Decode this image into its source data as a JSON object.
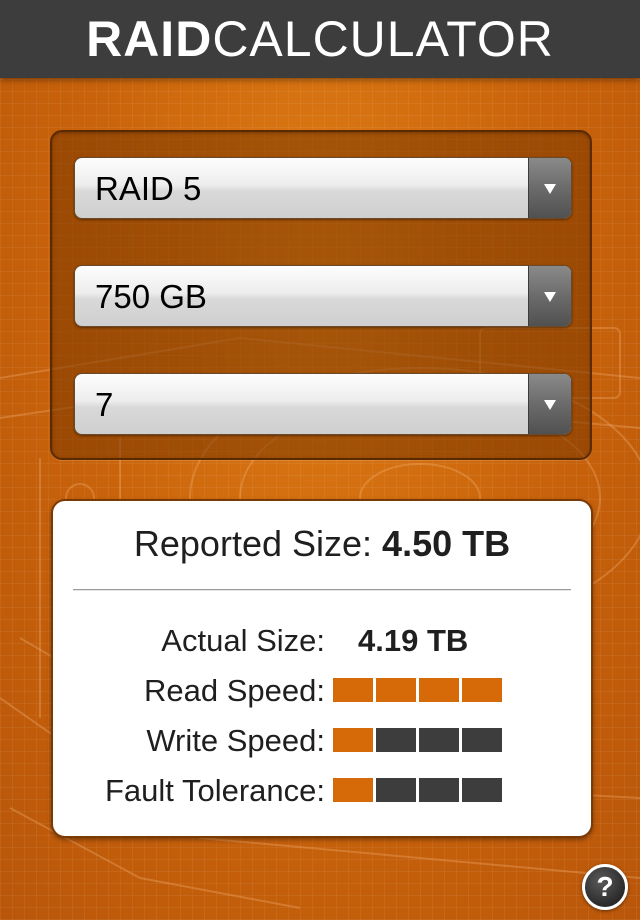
{
  "header": {
    "title_bold": "RAID",
    "title_light": "CALCULATOR"
  },
  "selectors": {
    "raid_level": "RAID 5",
    "drive_size": "750 GB",
    "drive_count": "7"
  },
  "results": {
    "reported_label": "Reported Size:",
    "reported_value": "4.50 TB",
    "actual_label": "Actual Size:",
    "actual_value": "4.19 TB",
    "read_label": "Read Speed:",
    "read_level": 4,
    "write_label": "Write Speed:",
    "write_level": 1,
    "fault_label": "Fault Tolerance:",
    "fault_level": 1,
    "meter_max": 4
  },
  "help": {
    "icon": "question-icon",
    "glyph": "?"
  },
  "colors": {
    "accent": "#d66a08",
    "meter_off": "#3d3d3d",
    "header_bg": "#3d3d3d"
  }
}
